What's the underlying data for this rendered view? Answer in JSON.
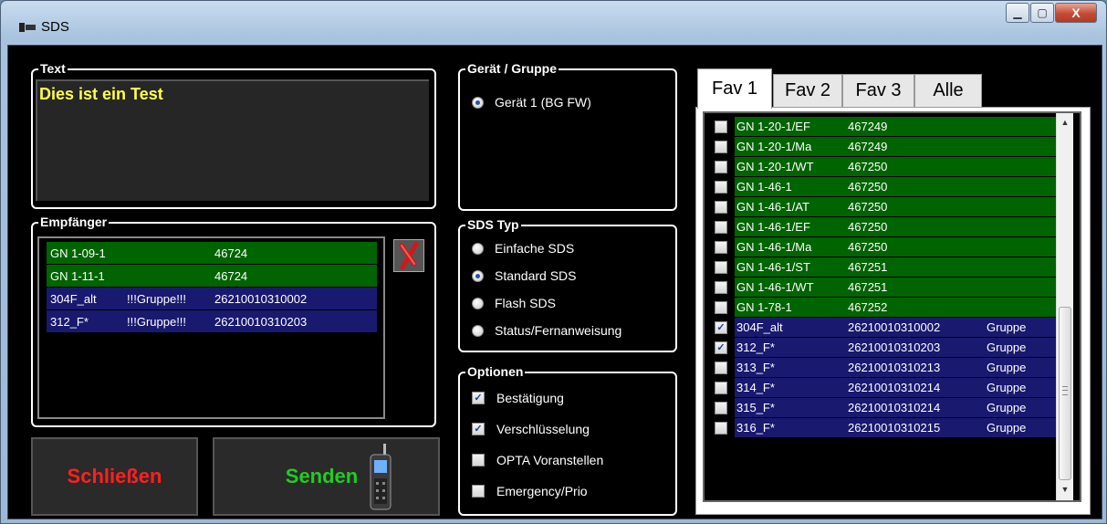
{
  "window": {
    "title": "SDS",
    "minimize": "▁",
    "maximize": "▢",
    "close": "X"
  },
  "text_group": {
    "legend": "Text",
    "value": "Dies ist ein Test"
  },
  "recipients": {
    "legend": "Empfänger",
    "rows": [
      {
        "name": "GN 1-09-1",
        "type": "",
        "id": "46724",
        "color": "#006400"
      },
      {
        "name": "GN 1-11-1",
        "type": "",
        "id": "46724",
        "color": "#006400"
      },
      {
        "name": "304F_alt",
        "type": "!!!Gruppe!!!",
        "id": "26210010310002",
        "color": "#191970"
      },
      {
        "name": "312_F*",
        "type": "!!!Gruppe!!!",
        "id": "26210010310203",
        "color": "#191970"
      }
    ]
  },
  "buttons": {
    "close": "Schließen",
    "send": "Senden",
    "close_color": "#ff2020",
    "send_color": "#22cc22"
  },
  "device_group": {
    "legend": "Gerät / Gruppe",
    "options": [
      {
        "label": "Gerät 1 (BG FW)",
        "selected": true
      }
    ]
  },
  "sds_type": {
    "legend": "SDS Typ",
    "options": [
      {
        "label": "Einfache SDS",
        "selected": false
      },
      {
        "label": "Standard SDS",
        "selected": true
      },
      {
        "label": "Flash SDS",
        "selected": false
      },
      {
        "label": "Status/Fernanweisung",
        "selected": false
      }
    ]
  },
  "options": {
    "legend": "Optionen",
    "items": [
      {
        "label": "Bestätigung",
        "checked": true
      },
      {
        "label": "Verschlüsselung",
        "checked": true
      },
      {
        "label": "OPTA Voranstellen",
        "checked": false
      },
      {
        "label": "Emergency/Prio",
        "checked": false
      }
    ]
  },
  "tabs": [
    {
      "label": "Fav 1",
      "active": true
    },
    {
      "label": "Fav 2",
      "active": false
    },
    {
      "label": "Fav 3",
      "active": false
    },
    {
      "label": "Alle",
      "active": false
    }
  ],
  "favorites": [
    {
      "name": "GN 1-20-1/EF",
      "id": "467249",
      "type": "",
      "checked": false,
      "color": "#006400"
    },
    {
      "name": "GN 1-20-1/Ma",
      "id": "467249",
      "type": "",
      "checked": false,
      "color": "#006400"
    },
    {
      "name": "GN 1-20-1/WT",
      "id": "467250",
      "type": "",
      "checked": false,
      "color": "#006400"
    },
    {
      "name": "GN 1-46-1",
      "id": "467250",
      "type": "",
      "checked": false,
      "color": "#006400"
    },
    {
      "name": "GN 1-46-1/AT",
      "id": "467250",
      "type": "",
      "checked": false,
      "color": "#006400"
    },
    {
      "name": "GN 1-46-1/EF",
      "id": "467250",
      "type": "",
      "checked": false,
      "color": "#006400"
    },
    {
      "name": "GN 1-46-1/Ma",
      "id": "467250",
      "type": "",
      "checked": false,
      "color": "#006400"
    },
    {
      "name": "GN 1-46-1/ST",
      "id": "467251",
      "type": "",
      "checked": false,
      "color": "#006400"
    },
    {
      "name": "GN 1-46-1/WT",
      "id": "467251",
      "type": "",
      "checked": false,
      "color": "#006400"
    },
    {
      "name": "GN 1-78-1",
      "id": "467252",
      "type": "",
      "checked": false,
      "color": "#006400"
    },
    {
      "name": "304F_alt",
      "id": "26210010310002",
      "type": "Gruppe",
      "checked": true,
      "color": "#191970"
    },
    {
      "name": "312_F*",
      "id": "26210010310203",
      "type": "Gruppe",
      "checked": true,
      "color": "#191970"
    },
    {
      "name": "313_F*",
      "id": "26210010310213",
      "type": "Gruppe",
      "checked": false,
      "color": "#191970"
    },
    {
      "name": "314_F*",
      "id": "26210010310214",
      "type": "Gruppe",
      "checked": false,
      "color": "#191970"
    },
    {
      "name": "315_F*",
      "id": "26210010310214",
      "type": "Gruppe",
      "checked": false,
      "color": "#191970"
    },
    {
      "name": "316_F*",
      "id": "26210010310215",
      "type": "Gruppe",
      "checked": false,
      "color": "#191970"
    }
  ]
}
